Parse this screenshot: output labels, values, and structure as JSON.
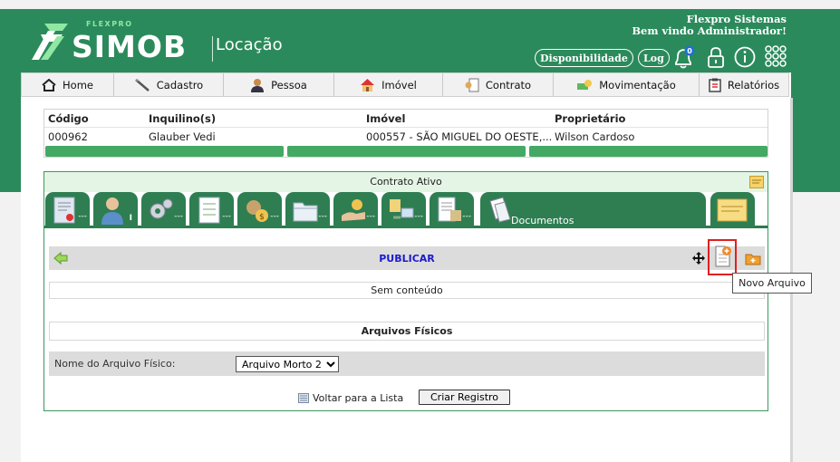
{
  "brand": {
    "small": "FLEXPRO",
    "name": "SIMOB",
    "module": "Locação"
  },
  "header": {
    "company": "Flexpro Sistemas",
    "welcome": "Bem vindo Administrador!",
    "disponibilidade_label": "Disponibilidade",
    "log_label": "Log",
    "notification_count": "0"
  },
  "nav": {
    "items": [
      {
        "label": "Home",
        "icon": "home-icon"
      },
      {
        "label": "Cadastro",
        "icon": "pen-icon"
      },
      {
        "label": "Pessoa",
        "icon": "person-icon"
      },
      {
        "label": "Imóvel",
        "icon": "house-icon"
      },
      {
        "label": "Contrato",
        "icon": "contract-icon"
      },
      {
        "label": "Movimentação",
        "icon": "money-icon"
      },
      {
        "label": "Relatórios",
        "icon": "report-icon"
      }
    ]
  },
  "info": {
    "headers": {
      "codigo": "Código",
      "inquilino": "Inquilino(s)",
      "imovel": "Imóvel",
      "proprietario": "Proprietário"
    },
    "row": {
      "codigo": "000962",
      "inquilino": "Glauber Vedi",
      "imovel": "000557 - SÃO MIGUEL DO OESTE,...",
      "proprietario": "Wilson Cardoso"
    }
  },
  "contract": {
    "title": "Contrato Ativo",
    "tab_placeholder": "---",
    "active_tab_label": "Documentos",
    "toolbar_title": "PUBLICAR",
    "empty_text": "Sem conteúdo",
    "tooltip": "Novo Arquivo",
    "arquivos_title": "Arquivos Físicos",
    "arquivo_label": "Nome do Arquivo Físico:",
    "arquivo_selected": "Arquivo Morto 2",
    "back_link": "Voltar para a Lista",
    "create_button": "Criar Registro"
  }
}
